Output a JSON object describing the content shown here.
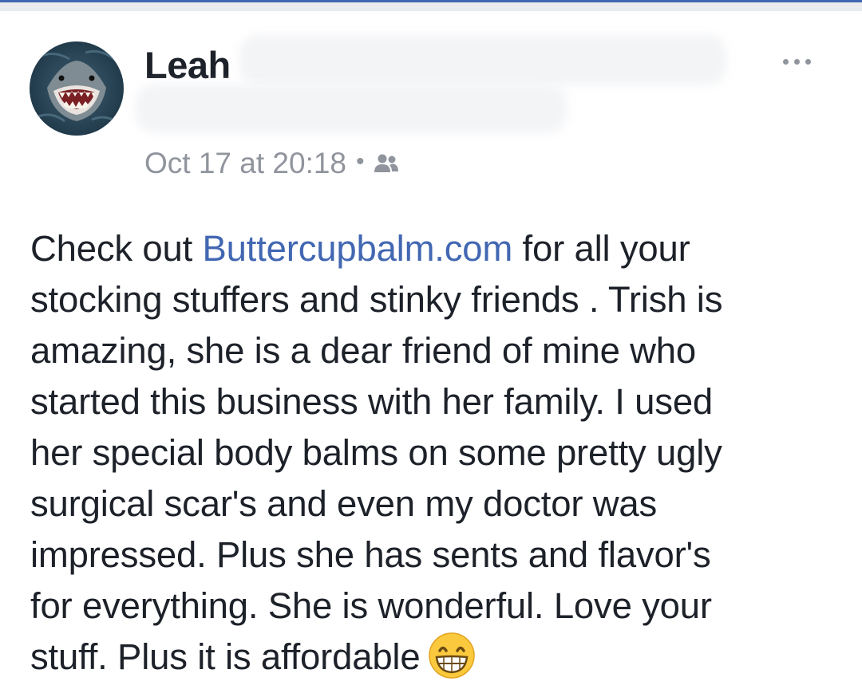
{
  "post": {
    "author": {
      "name": "Leah",
      "avatar_icon": "shark-avatar"
    },
    "timestamp": "Oct 17 at 20:18",
    "separator": "•",
    "audience_icon": "friends-icon",
    "more_icon": "more-options-icon",
    "body": {
      "line1_before": "Check out ",
      "link_text": "Buttercupbalm.com",
      "line1_after": " for all your",
      "lines": [
        "stocking stuffers and stinky friends . Trish is",
        "amazing, she is a dear friend of mine who",
        "started this business with her family. I used",
        "her special body balms on some pretty ugly",
        "surgical scar's and even my doctor was",
        "impressed. Plus she has sents and flavor's",
        "for everything. She is wonderful. Love your"
      ],
      "last_line": "stuff. Plus it is affordable",
      "emoji": "grinning-face-with-smiling-eyes-emoji"
    }
  },
  "colors": {
    "link": "#4267b2",
    "text": "#1d2129",
    "meta": "#90949c",
    "accent": "#4267b2"
  }
}
